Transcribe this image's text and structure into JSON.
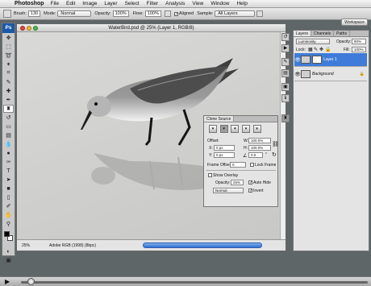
{
  "menubar": {
    "app_name": "Photoshop",
    "items": [
      "File",
      "Edit",
      "Image",
      "Layer",
      "Select",
      "Filter",
      "Analysis",
      "View",
      "Window",
      "Help"
    ]
  },
  "options": {
    "brush_label": "Brush:",
    "brush_size": "130",
    "mode_label": "Mode:",
    "mode_value": "Normal",
    "opacity_label": "Opacity:",
    "opacity_value": "100%",
    "flow_label": "Flow:",
    "flow_value": "100%",
    "aligned_label": "Aligned",
    "sample_label": "Sample:",
    "sample_value": "All Layers",
    "workspace_label": "Workspace"
  },
  "document": {
    "title": "WaterBird.psd @ 25% (Layer 1, RGB/8)",
    "zoom": "25%",
    "profile": "Adobe RGB (1998) (8bpc)"
  },
  "layers_panel": {
    "tabs": [
      "Layers",
      "Channels",
      "Paths"
    ],
    "blend_mode": "Luminosity",
    "opacity_label": "Opacity:",
    "opacity_value": "90%",
    "lock_label": "Lock:",
    "fill_label": "Fill:",
    "fill_value": "100%",
    "layers": [
      {
        "name": "Layer 1",
        "selected": true
      },
      {
        "name": "Background",
        "selected": false
      }
    ]
  },
  "clone_source": {
    "title": "Clone Source",
    "offset_label": "Offset:",
    "x_label": "X:",
    "x_value": "0 px",
    "y_label": "Y:",
    "y_value": "0 px",
    "w_label": "W:",
    "w_value": "100.0%",
    "h_label": "H:",
    "h_value": "100.0%",
    "angle_value": "0.0",
    "frame_offset_label": "Frame Offset:",
    "frame_offset_value": "0",
    "lock_frame_label": "Lock Frame",
    "show_overlay_label": "Show Overlay",
    "opacity_label": "Opacity:",
    "opacity_value": "25%",
    "auto_hide_label": "Auto Hide",
    "mode_value": "Normal",
    "invert_label": "Invert"
  },
  "colors": {
    "selection_blue": "#2f6fd0",
    "photoshop_blue": "#1a59a6"
  }
}
